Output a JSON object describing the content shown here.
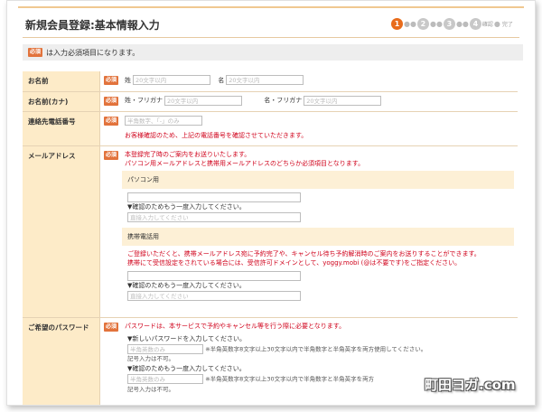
{
  "page": {
    "title": "新規会員登録:基本情報入力",
    "steps": [
      "1",
      "2",
      "3",
      "4"
    ],
    "step_labels": [
      "確認",
      "完了"
    ],
    "notice": "は入力必須項目になります。",
    "required_badge": "必須"
  },
  "form": {
    "name": {
      "label": "お名前",
      "sei_label": "姓",
      "sei_placeholder": "20文字以内",
      "mei_label": "名",
      "mei_placeholder": "20文字以内"
    },
    "kana": {
      "label": "お名前(カナ)",
      "sei_label": "姓・フリガナ",
      "sei_placeholder": "20文字以内",
      "mei_label": "名・フリガナ",
      "mei_placeholder": "20文字以内"
    },
    "phone": {
      "label": "連絡先電話番号",
      "placeholder": "半角数字、「-」のみ",
      "note": "お客様確認のため、上記の電話番号を確認させていただきます。"
    },
    "email": {
      "label": "メールアドレス",
      "intro_1": "本登録完了時のご案内をお送りいたします。",
      "intro_2": "パソコン用メールアドレスと携帯用メールアドレスのどちらか必須項目となります。",
      "pc_heading": "パソコン用",
      "pc_confirm": "▼確認のためもう一度入力してください。",
      "pc_confirm_placeholder": "直接入力してください",
      "mobile_heading": "携帯電話用",
      "mobile_note_1": "ご登録いただくと、携帯メールアドレス宛に予約完了や、キャンセル待ち予約解消時のご案内をお送りすることができます。",
      "mobile_note_2": "携帯にて受信設定をされている場合には、受信許可ドメインとして、yoggy.mobi (@は不要です)をご指定ください。",
      "mobile_confirm": "▼確認のためもう一度入力してください。",
      "mobile_confirm_placeholder": "直接入力してください"
    },
    "password": {
      "label": "ご希望のパスワード",
      "intro": "パスワードは、本サービスで予約やキャンセル等を行う際に必要となります。",
      "new_label": "▼新しいパスワードを入力してください。",
      "new_placeholder": "半角英数のみ",
      "rule": "※半角英数字8文字以上30文字以内で半角数字と半角英字を両方使用してください。",
      "symbol_note": "記号入力は不可。",
      "confirm_label": "▼確認のためもう一度入力してください。",
      "confirm_placeholder": "半角英数のみ",
      "confirm_rule": "※半角英数字8文字以上30文字以内で半角数字と半角英字を両方",
      "confirm_symbol_note": "記号入力は不可。"
    }
  },
  "watermark": "町田ヨガ.com",
  "colors": {
    "accent": "#e86c1c",
    "required": "#e2733c",
    "label_bg": "#fdebc8",
    "error_text": "#d0021b"
  }
}
